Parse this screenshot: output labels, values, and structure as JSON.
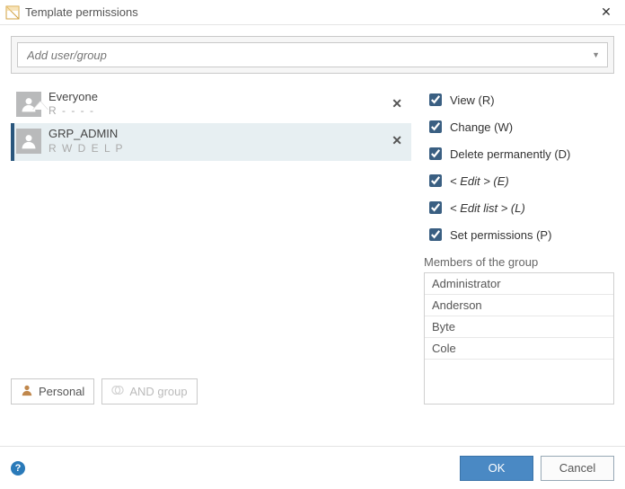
{
  "window": {
    "title": "Template permissions"
  },
  "search": {
    "placeholder": "Add user/group"
  },
  "acl": {
    "items": [
      {
        "name": "Everyone",
        "perm": "R - - - -",
        "selected": false
      },
      {
        "name": "GRP_ADMIN",
        "perm": "R W D E L P",
        "selected": true
      }
    ]
  },
  "permissions": [
    {
      "label": "View (R)",
      "italic": false,
      "checked": true
    },
    {
      "label": "Change (W)",
      "italic": false,
      "checked": true
    },
    {
      "label": "Delete permanently (D)",
      "italic": false,
      "checked": true
    },
    {
      "label": "< Edit > (E)",
      "italic": true,
      "checked": true
    },
    {
      "label": "< Edit list > (L)",
      "italic": true,
      "checked": true
    },
    {
      "label": "Set permissions (P)",
      "italic": false,
      "checked": true
    }
  ],
  "members": {
    "title": "Members of the group",
    "list": [
      "Administrator",
      "Anderson",
      "Byte",
      "Cole"
    ]
  },
  "buttons": {
    "personal": "Personal",
    "and_group": "AND group",
    "ok": "OK",
    "cancel": "Cancel"
  }
}
